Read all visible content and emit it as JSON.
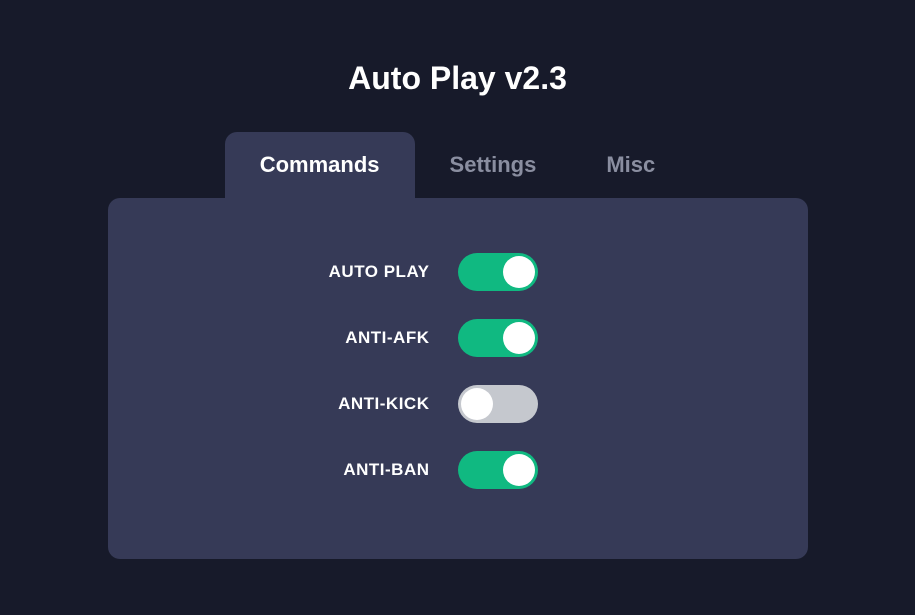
{
  "title": "Auto Play v2.3",
  "tabs": [
    {
      "label": "Commands",
      "active": true
    },
    {
      "label": "Settings",
      "active": false
    },
    {
      "label": "Misc",
      "active": false
    }
  ],
  "toggles": [
    {
      "label": "AUTO PLAY",
      "state": "on"
    },
    {
      "label": "ANTI-AFK",
      "state": "on"
    },
    {
      "label": "ANTI-KICK",
      "state": "off"
    },
    {
      "label": "ANTI-BAN",
      "state": "on"
    }
  ],
  "colors": {
    "background": "#171a2a",
    "panel": "#363a57",
    "toggle_on": "#10b981",
    "toggle_off": "#c5c8ce"
  }
}
